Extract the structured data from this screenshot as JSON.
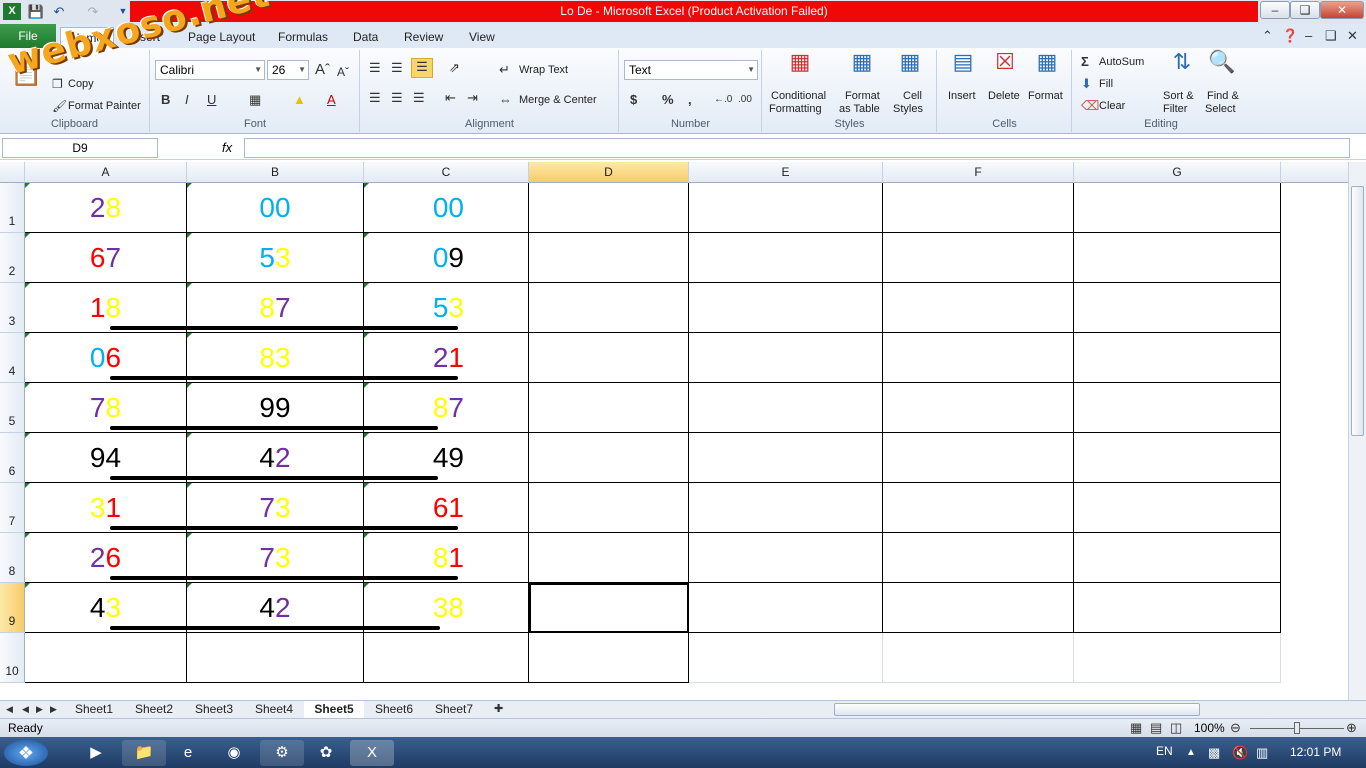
{
  "window": {
    "title": "Lo De  -  Microsoft Excel (Product Activation Failed)"
  },
  "watermark": "webxoso.net",
  "tabs": [
    "File",
    "Home",
    "Insert",
    "Page Layout",
    "Formulas",
    "Data",
    "Review",
    "View"
  ],
  "ribbon": {
    "clipboard": {
      "copy": "Copy",
      "format_painter": "Format Painter",
      "label": "Clipboard"
    },
    "font": {
      "name": "Calibri",
      "size": "26",
      "label": "Font"
    },
    "alignment": {
      "wrap": "Wrap Text",
      "merge": "Merge & Center",
      "label": "Alignment"
    },
    "number": {
      "format": "Text",
      "label": "Number"
    },
    "styles": {
      "conditional_1": "Conditional",
      "conditional_2": "Formatting",
      "format_table_1": "Format",
      "format_table_2": "as Table",
      "cell_styles_1": "Cell",
      "cell_styles_2": "Styles",
      "label": "Styles"
    },
    "cells": {
      "insert": "Insert",
      "delete": "Delete",
      "format": "Format",
      "label": "Cells"
    },
    "editing": {
      "autosum": "AutoSum",
      "fill": "Fill",
      "clear": "Clear",
      "sort_1": "Sort &",
      "sort_2": "Filter",
      "find_1": "Find &",
      "find_2": "Select",
      "label": "Editing"
    }
  },
  "formula_bar": {
    "name_box": "D9",
    "fx": "fx",
    "value": ""
  },
  "columns": [
    "A",
    "B",
    "C",
    "D",
    "E",
    "F",
    "G"
  ],
  "rows": [
    "1",
    "2",
    "3",
    "4",
    "5",
    "6",
    "7",
    "8",
    "9",
    "10"
  ],
  "colors": {
    "purple": "#7030a0",
    "yellow": "#ffff00",
    "cyan": "#00b0f0",
    "red": "#ff0000",
    "black": "#000000"
  },
  "grid": [
    [
      [
        [
          "2",
          "purple"
        ],
        [
          "8",
          "yellow"
        ]
      ],
      [
        [
          "0",
          "cyan"
        ],
        [
          "0",
          "cyan"
        ]
      ],
      [
        [
          "0",
          "cyan"
        ],
        [
          "0",
          "cyan"
        ]
      ]
    ],
    [
      [
        [
          "6",
          "red"
        ],
        [
          "7",
          "purple"
        ]
      ],
      [
        [
          "5",
          "cyan"
        ],
        [
          "3",
          "yellow"
        ]
      ],
      [
        [
          "0",
          "cyan"
        ],
        [
          "9",
          "black"
        ]
      ]
    ],
    [
      [
        [
          "1",
          "red"
        ],
        [
          "8",
          "yellow"
        ]
      ],
      [
        [
          "8",
          "yellow"
        ],
        [
          "7",
          "purple"
        ]
      ],
      [
        [
          "5",
          "cyan"
        ],
        [
          "3",
          "yellow"
        ]
      ]
    ],
    [
      [
        [
          "0",
          "cyan"
        ],
        [
          "6",
          "red"
        ]
      ],
      [
        [
          "8",
          "yellow"
        ],
        [
          "3",
          "yellow"
        ]
      ],
      [
        [
          "2",
          "purple"
        ],
        [
          "1",
          "red"
        ]
      ]
    ],
    [
      [
        [
          "7",
          "purple"
        ],
        [
          "8",
          "yellow"
        ]
      ],
      [
        [
          "9",
          "black"
        ],
        [
          "9",
          "black"
        ]
      ],
      [
        [
          "8",
          "yellow"
        ],
        [
          "7",
          "purple"
        ]
      ]
    ],
    [
      [
        [
          "9",
          "black"
        ],
        [
          "4",
          "black"
        ]
      ],
      [
        [
          "4",
          "black"
        ],
        [
          "2",
          "purple"
        ]
      ],
      [
        [
          "4",
          "black"
        ],
        [
          "9",
          "black"
        ]
      ]
    ],
    [
      [
        [
          "3",
          "yellow"
        ],
        [
          "1",
          "red"
        ]
      ],
      [
        [
          "7",
          "purple"
        ],
        [
          "3",
          "yellow"
        ]
      ],
      [
        [
          "6",
          "red"
        ],
        [
          "1",
          "red"
        ]
      ]
    ],
    [
      [
        [
          "2",
          "purple"
        ],
        [
          "6",
          "red"
        ]
      ],
      [
        [
          "7",
          "purple"
        ],
        [
          "3",
          "yellow"
        ]
      ],
      [
        [
          "8",
          "yellow"
        ],
        [
          "1",
          "red"
        ]
      ]
    ],
    [
      [
        [
          "4",
          "black"
        ],
        [
          "3",
          "yellow"
        ]
      ],
      [
        [
          "4",
          "black"
        ],
        [
          "2",
          "purple"
        ]
      ],
      [
        [
          "3",
          "yellow"
        ],
        [
          "8",
          "yellow"
        ]
      ]
    ]
  ],
  "sheet_tabs": [
    "Sheet1",
    "Sheet2",
    "Sheet3",
    "Sheet4",
    "Sheet5",
    "Sheet6",
    "Sheet7"
  ],
  "active_sheet": "Sheet5",
  "status": {
    "ready": "Ready",
    "zoom": "100%"
  },
  "taskbar": {
    "lang": "EN",
    "time": "12:01 PM"
  }
}
